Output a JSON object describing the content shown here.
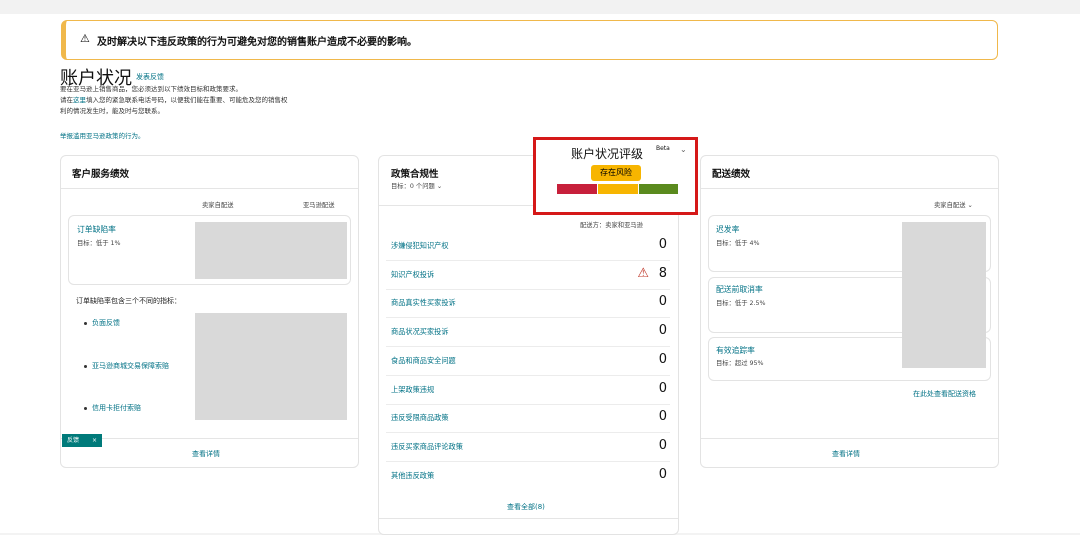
{
  "alert": {
    "text": "及时解决以下违反政策的行为可避免对您的销售账户造成不必要的影响。"
  },
  "header": {
    "title": "账户状况",
    "feedback_link": "发表反馈"
  },
  "intro": {
    "line1": "要在亚马逊上销售商品，您必须达到以下绩效目标和政策要求。",
    "line2_prefix": "请在",
    "line2_link": "这里",
    "line2_suffix": "填入您的紧急联系电话号码，以便我们能在重要、可能危及您的销售权",
    "line3": "利的情况发生时，能及时与您联系。",
    "report_link": "举报滥用亚马逊政策的行为。"
  },
  "customer_service": {
    "title": "客户服务绩效",
    "col_seller": "卖家自配送",
    "col_amazon": "亚马逊配送",
    "odr_label": "订单缺陷率",
    "odr_target": "目标：低于 1%",
    "metrics_intro": "订单缺陷率包含三个不同的指标：",
    "bullets": [
      "负面反馈",
      "亚马逊商城交易保障索赔",
      "信用卡拒付索赔"
    ],
    "view_details": "查看详情",
    "tag": "反馈"
  },
  "policy": {
    "title": "政策合规性",
    "subtitle": "目标：",
    "subtitle_value": "0 个问题",
    "dist": "配送方：卖家和亚马逊",
    "items": [
      {
        "label": "涉嫌侵犯知识产权",
        "count": "0"
      },
      {
        "label": "知识产权投诉",
        "count": "8"
      },
      {
        "label": "商品真实性买家投诉",
        "count": "0"
      },
      {
        "label": "商品状况买家投诉",
        "count": "0"
      },
      {
        "label": "食品和商品安全问题",
        "count": "0"
      },
      {
        "label": "上架政策违规",
        "count": "0"
      },
      {
        "label": "违反受限商品政策",
        "count": "0"
      },
      {
        "label": "违反买家商品评论政策",
        "count": "0"
      },
      {
        "label": "其他违反政策",
        "count": "0"
      }
    ],
    "view_all": "查看全部(8)"
  },
  "rating": {
    "title": "账户状况评级",
    "beta": "Beta",
    "status": "存在风险",
    "colors": [
      "#c7203b",
      "#f7b500",
      "#5a8a1e"
    ]
  },
  "shipping": {
    "title": "配送绩效",
    "col_seller": "卖家自配送",
    "metrics": [
      {
        "label": "迟发率",
        "target": "目标：低于 4%"
      },
      {
        "label": "配送前取消率",
        "target": "目标：低于 2.5%"
      },
      {
        "label": "有效追踪率",
        "target": "目标：超过 95%"
      }
    ],
    "view_shipping": "在此处查看配送资格",
    "view_details": "查看详情"
  }
}
